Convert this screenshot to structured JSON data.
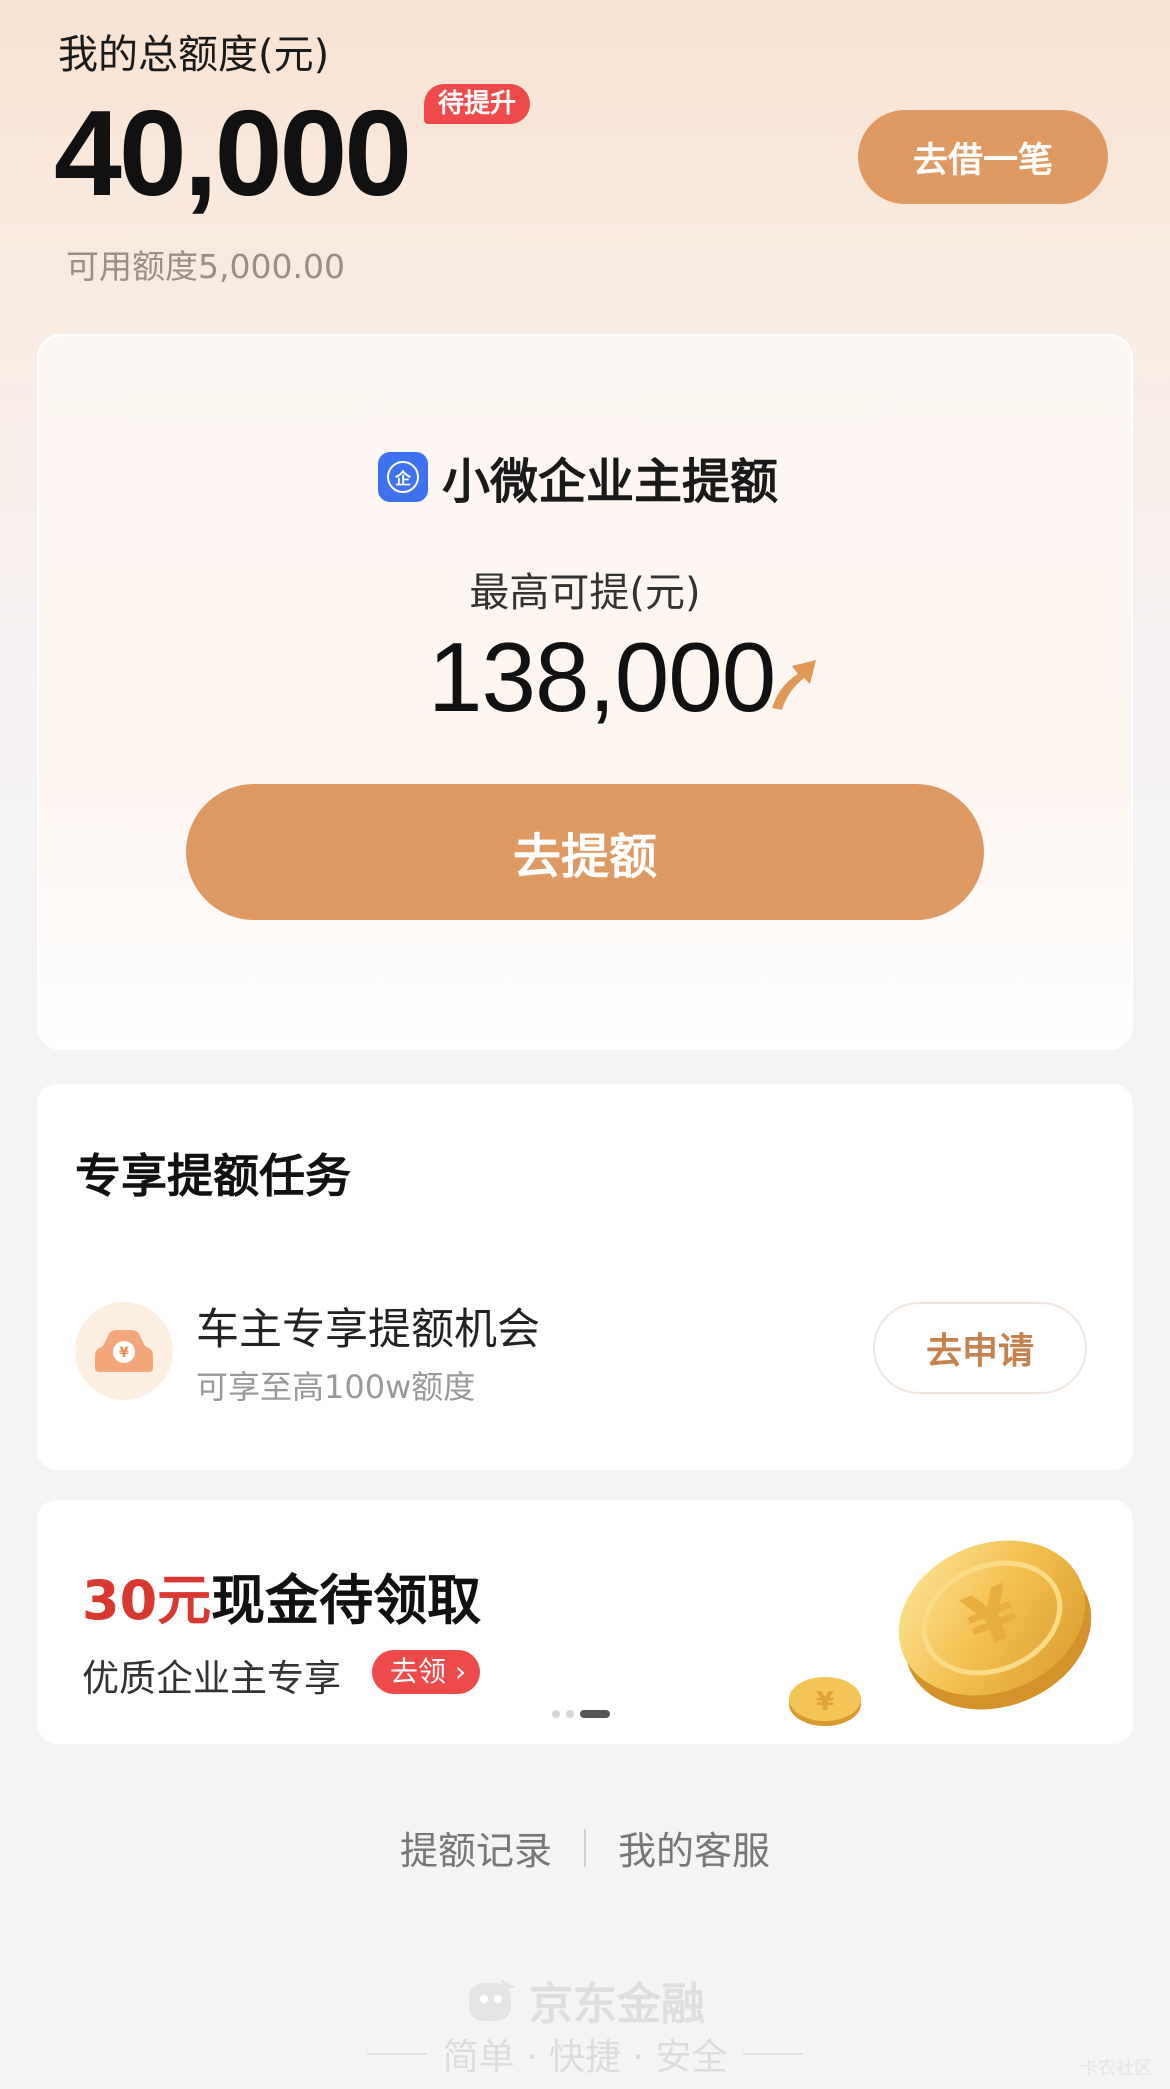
{
  "header": {
    "title": "我的总额度(元)",
    "total_amount": "40,000",
    "badge": "待提升",
    "available": "可用额度5,000.00",
    "borrow_button": "去借一笔"
  },
  "main_card": {
    "logo_char": "企",
    "title": "小微企业主提额",
    "subtitle": "最高可提(元)",
    "amount": "138,000",
    "action_button": "去提额"
  },
  "tasks": {
    "title": "专享提额任务",
    "items": [
      {
        "icon": "car-coin-icon",
        "name": "车主专享提额机会",
        "desc": "可享至高100w额度",
        "button": "去申请"
      }
    ]
  },
  "promo": {
    "amount_text": "30元",
    "title_rest": "现金待领取",
    "subtitle": "优质企业主专享",
    "button": "去领 ›",
    "carousel_index": 3,
    "carousel_count": 3
  },
  "footer": {
    "links": [
      "提额记录",
      "我的客服"
    ],
    "brand": "京东金融",
    "slogan": "简单 · 快捷 · 安全",
    "watermark": "卡农社区"
  },
  "colors": {
    "accent": "#de9a62",
    "badge_red": "#ef4a4a",
    "promo_red": "#d9382e",
    "logo_blue": "#3f72f0"
  }
}
